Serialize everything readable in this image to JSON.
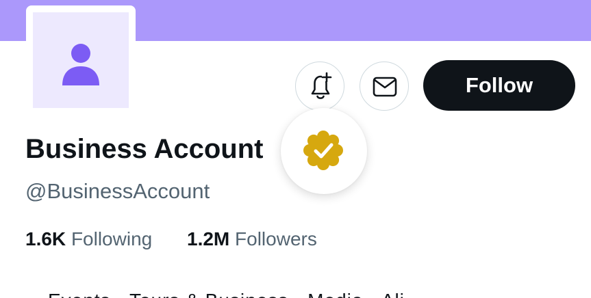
{
  "colors": {
    "banner": "#ab98fb",
    "avatar_bg": "#ede9fe",
    "avatar_figure": "#7c5cf4",
    "verified_badge": "#d6a80f",
    "follow_button": "#0f1419",
    "secondary_text": "#536471"
  },
  "profile": {
    "display_name": "Business Account",
    "handle": "@BusinessAccount",
    "verified_badge": "gold-check-badge-icon"
  },
  "actions": {
    "notify_icon": "bell-plus-icon",
    "message_icon": "envelope-icon",
    "follow_label": "Follow"
  },
  "stats": {
    "following_count": "1.6K",
    "following_label": "Following",
    "followers_count": "1.2M",
    "followers_label": "Followers"
  },
  "bio": {
    "cut_off_line": "Events · Tours & Business · Media · Ali"
  }
}
